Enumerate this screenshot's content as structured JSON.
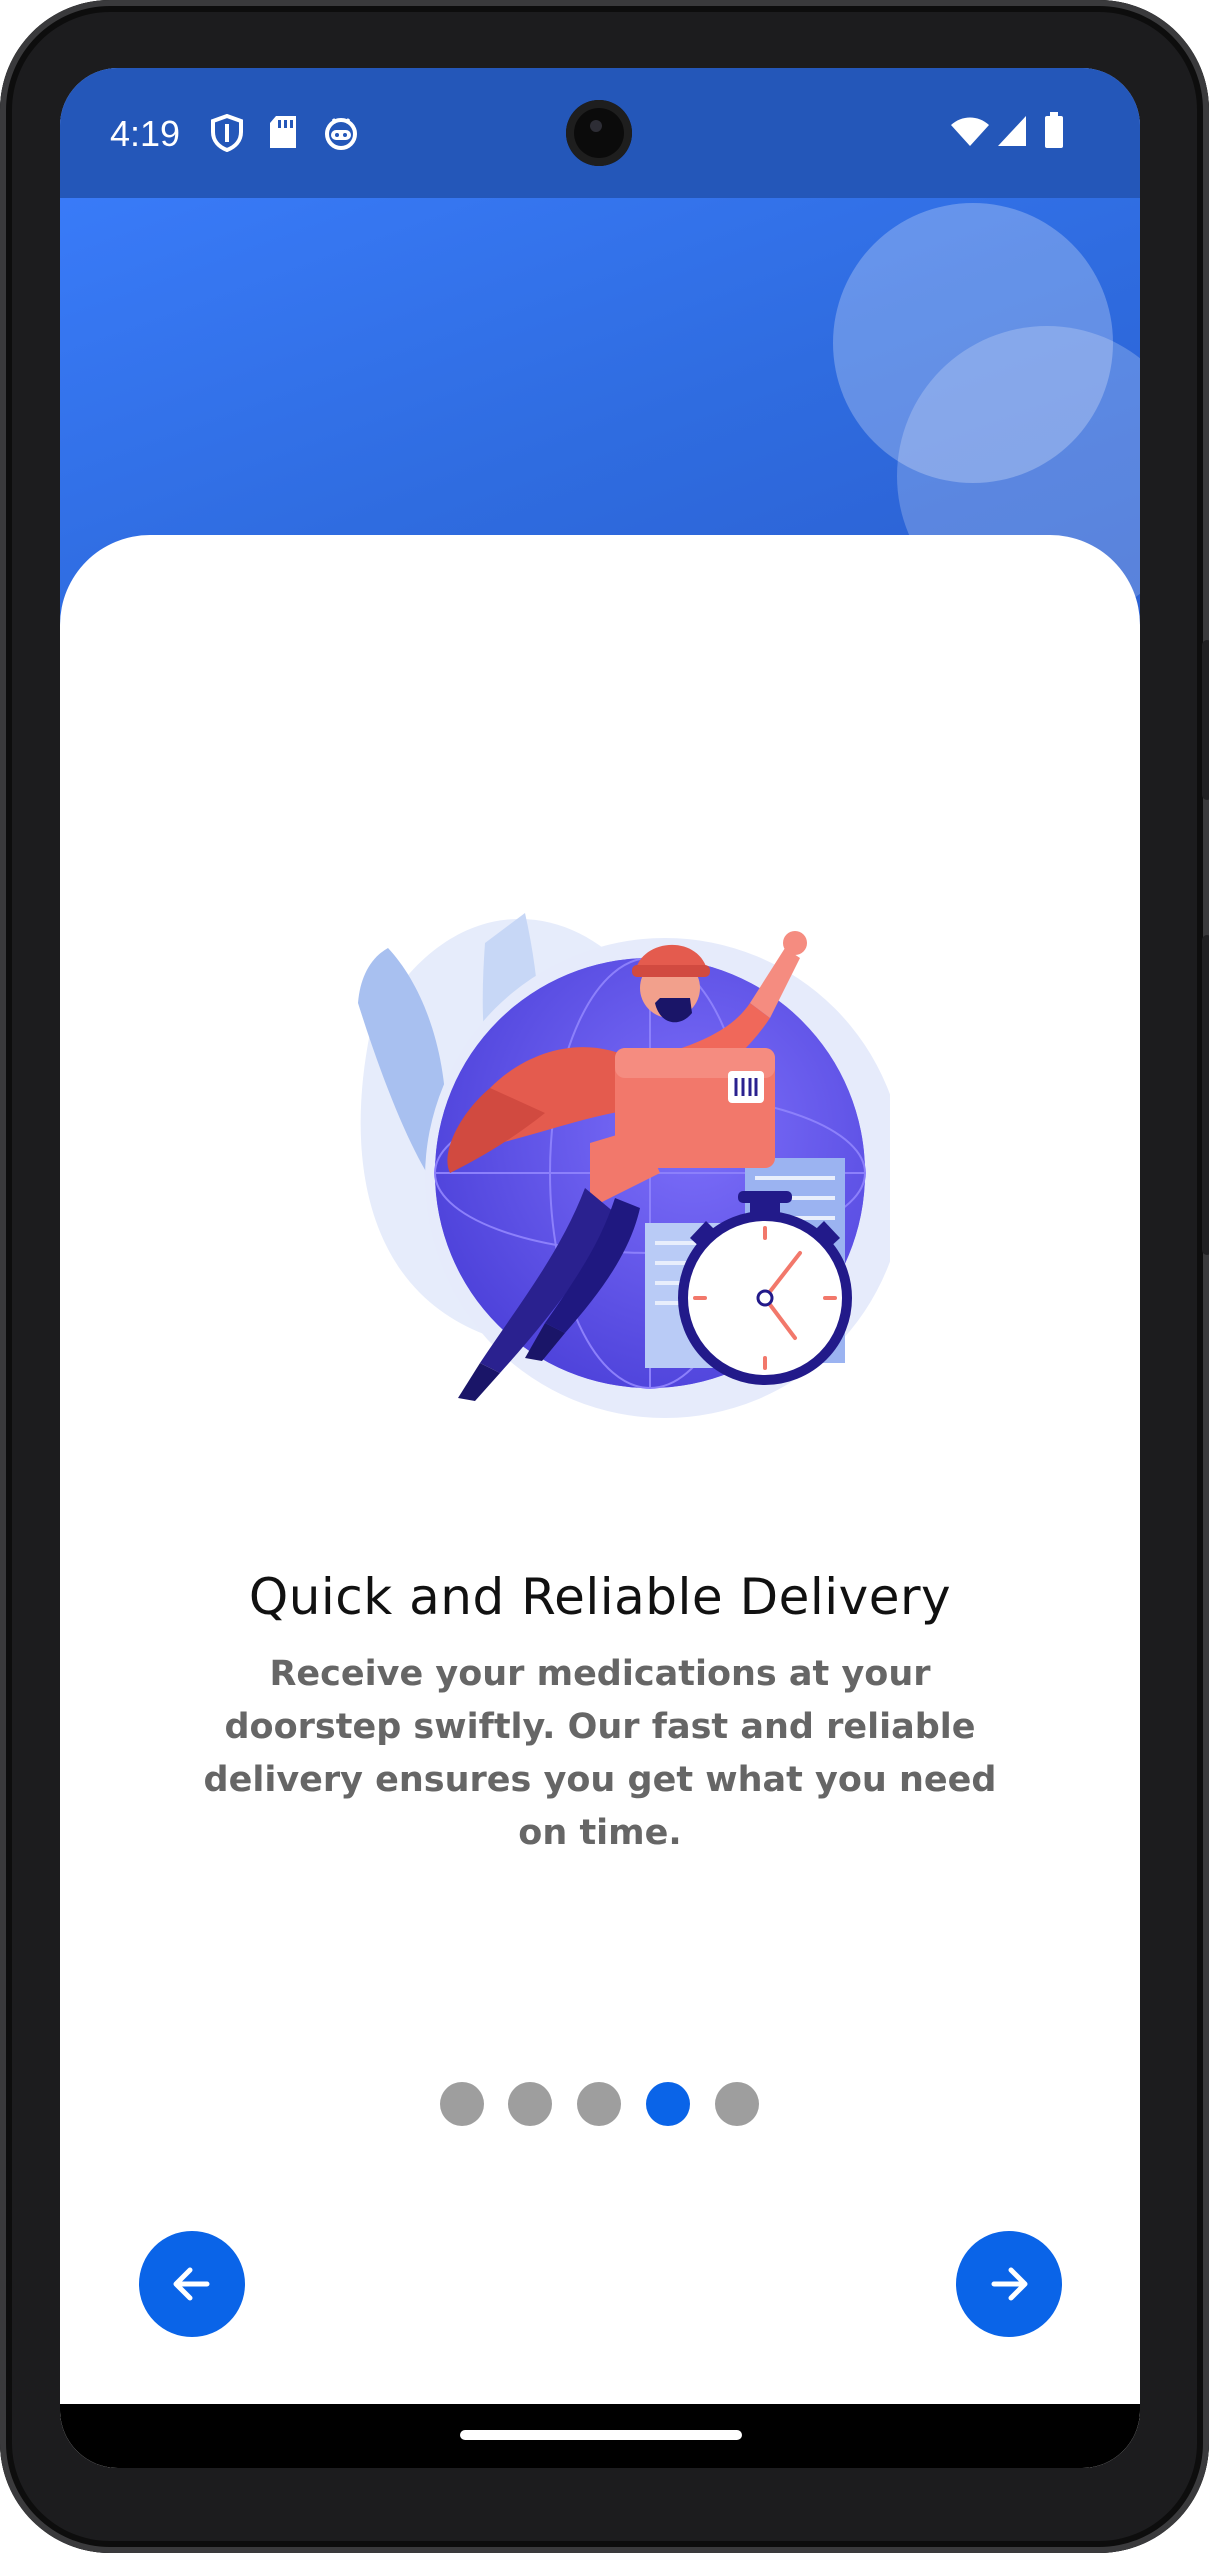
{
  "status_bar": {
    "time": "4:19",
    "left_icons": [
      "shield-icon",
      "sd-card-icon",
      "android-robot-icon"
    ],
    "right_icons": [
      "wifi-icon",
      "signal-icon",
      "battery-icon"
    ]
  },
  "onboarding": {
    "illustration": "delivery-superhero-illustration",
    "title": "Quick and Reliable Delivery",
    "description": "Receive your medications at your doorstep swiftly. Our fast and reliable delivery ensures you get what you need on time.",
    "page_indicator": {
      "total": 5,
      "active_index": 3
    }
  },
  "navigation": {
    "back_icon": "arrow-left-icon",
    "next_icon": "arrow-right-icon"
  },
  "colors": {
    "header_start": "#3c7fff",
    "header_end": "#2a5ccd",
    "status_bar": "#2457b9",
    "accent": "#0a64e8",
    "dot_inactive": "#9e9e9e",
    "title_text": "#111111",
    "description_text": "#666666"
  }
}
